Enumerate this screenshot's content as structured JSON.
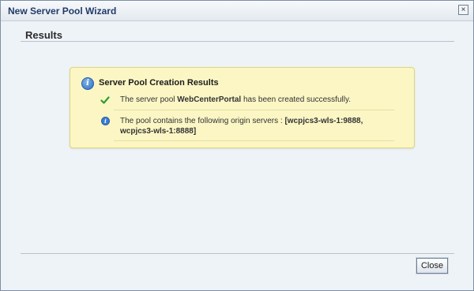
{
  "window": {
    "title": "New Server Pool Wizard",
    "close_glyph": "×"
  },
  "section": {
    "header": "Results"
  },
  "message": {
    "title": "Server Pool Creation Results",
    "info_icon_glyph": "i",
    "rows": [
      {
        "icon": "check-icon",
        "before": "The server pool ",
        "bold": "WebCenterPortal",
        "after": " has been created successfully."
      },
      {
        "icon": "info-icon",
        "before": "The pool contains the following origin servers : ",
        "bold": "[wcpjcs3-wls-1:9888, wcpjcs3-wls-1:8888]",
        "after": ""
      }
    ]
  },
  "footer": {
    "close_label": "Close"
  },
  "colors": {
    "message_background": "#fbf6c4",
    "message_border": "#dfd67a",
    "title_text": "#213a6b",
    "check_green": "#2e9b2e",
    "info_blue": "#2c6fc4"
  }
}
